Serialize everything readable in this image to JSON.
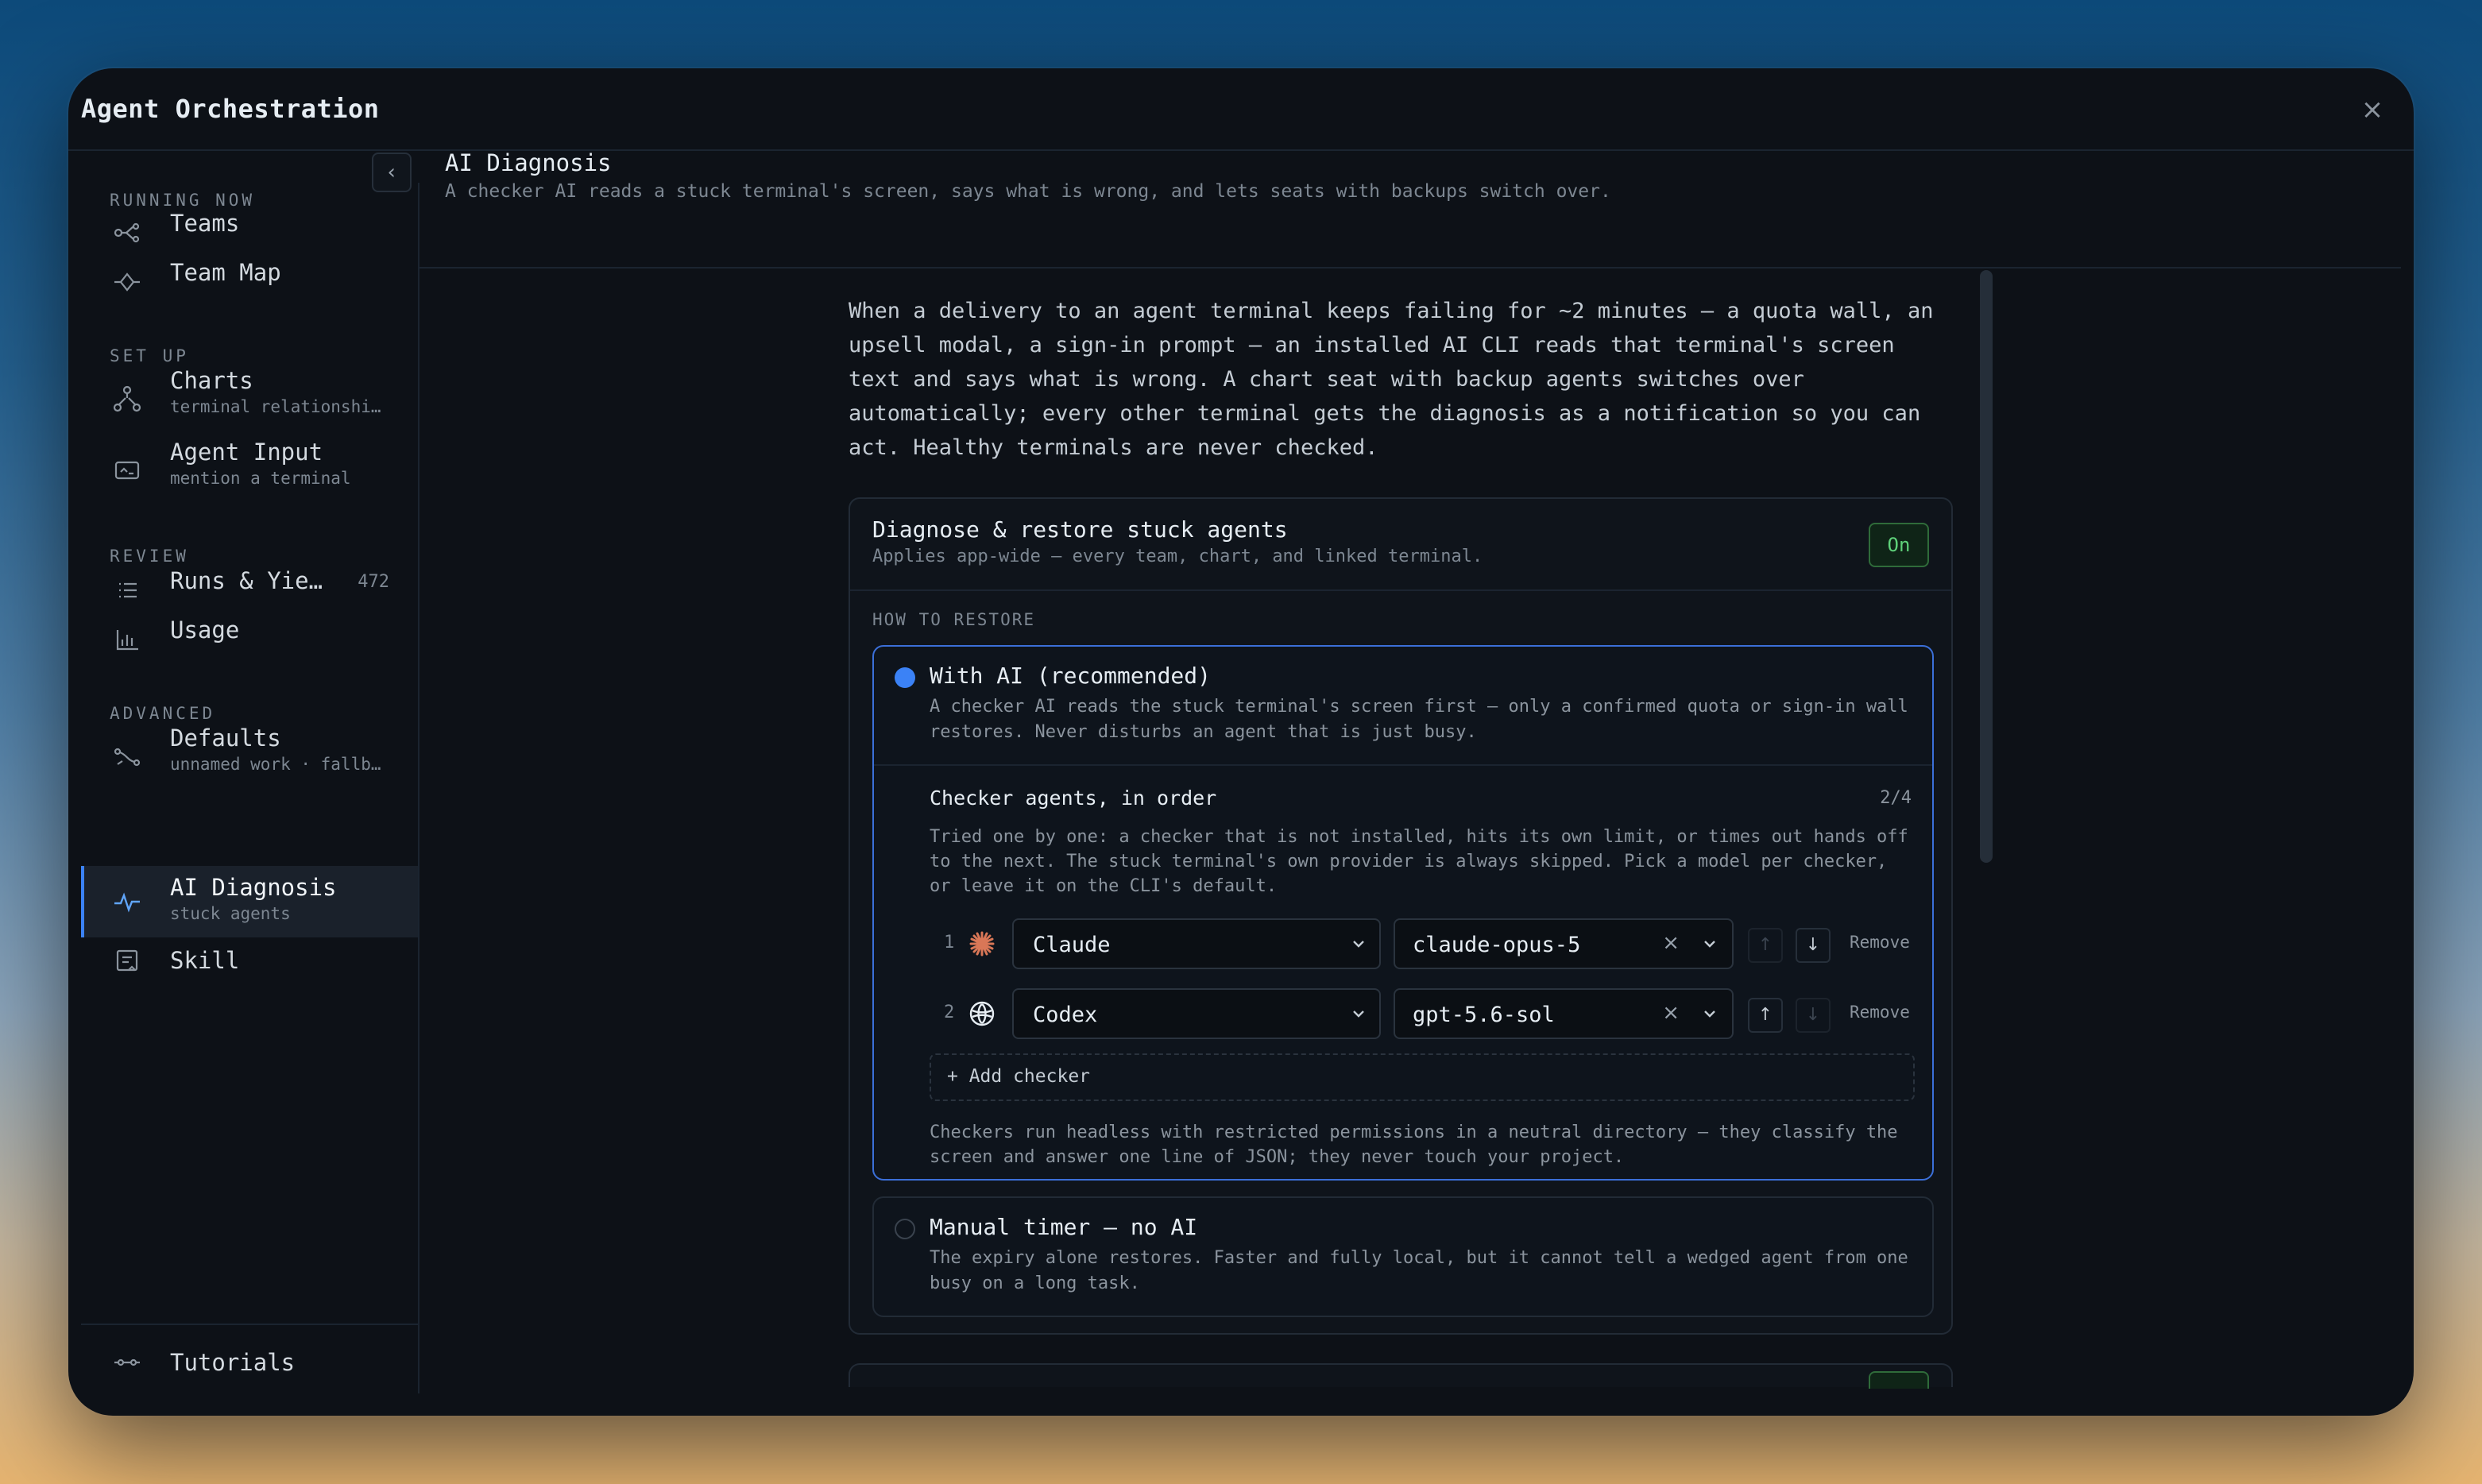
{
  "window": {
    "title": "Agent Orchestration",
    "close": "×"
  },
  "sidebar": {
    "collapse": "‹",
    "sections": {
      "running": "RUNNING NOW",
      "setup": "SET UP",
      "review": "REVIEW",
      "advanced": "ADVANCED"
    },
    "items": [
      {
        "label": "Teams",
        "icon": "teams-icon"
      },
      {
        "label": "Team Map",
        "icon": "map-icon"
      },
      {
        "label": "Charts",
        "sub": "terminal relationshi…",
        "icon": "chart-tree-icon"
      },
      {
        "label": "Agent Input",
        "sub": "mention a terminal",
        "icon": "input-icon"
      },
      {
        "label": "Runs & Yie…",
        "count": "472",
        "icon": "list-icon"
      },
      {
        "label": "Usage",
        "icon": "bar-chart-icon"
      },
      {
        "label": "Defaults",
        "sub": "unnamed work · fallb…",
        "icon": "route-icon"
      },
      {
        "label": "AI Diagnosis",
        "sub": "stuck agents",
        "icon": "pulse-icon",
        "active": true
      },
      {
        "label": "Skill",
        "icon": "skill-icon"
      }
    ],
    "footer": {
      "label": "Tutorials",
      "icon": "tutorials-icon"
    }
  },
  "main": {
    "title": "AI Diagnosis",
    "subtitle": "A checker AI reads a stuck terminal's screen, says what is wrong, and lets seats with backups switch over.",
    "intro": "When a delivery to an agent terminal keeps failing for ~2 minutes — a quota wall, an upsell modal, a sign-in prompt — an installed AI CLI reads that terminal's screen text and says what is wrong. A chart seat with backup agents switches over automatically; every other terminal gets the diagnosis as a notification so you can act. Healthy terminals are never checked."
  },
  "card": {
    "title": "Diagnose & restore stuck agents",
    "subtitle": "Applies app-wide — every team, chart, and linked terminal.",
    "toggle": "On",
    "how_label": "HOW TO RESTORE",
    "option_ai": {
      "title": "With AI (recommended)",
      "desc": "A checker AI reads the stuck terminal's screen first — only a confirmed quota or sign-in wall restores. Never disturbs an agent that is just busy.",
      "checkers_title": "Checker agents, in order",
      "checkers_count": "2/4",
      "checkers_desc": "Tried one by one: a checker that is not installed, hits its own limit, or times out hands off to the next. The stuck terminal's own provider is always skipped. Pick a model per checker, or leave it on the CLI's default.",
      "rows": [
        {
          "num": "1",
          "agent": "Claude",
          "model": "claude-opus-5",
          "remove": "Remove"
        },
        {
          "num": "2",
          "agent": "Codex",
          "model": "gpt-5.6-sol",
          "remove": "Remove"
        }
      ],
      "add": "+ Add checker",
      "note": "Checkers run headless with restricted permissions in a neutral directory — they classify the screen and answer one line of JSON; they never touch your project."
    },
    "option_manual": {
      "title": "Manual timer — no AI",
      "desc": "The expiry alone restores. Faster and fully local, but it cannot tell a wedged agent from one busy on a long task."
    }
  },
  "colors": {
    "accent": "#3b82f6",
    "on_green": "#5fd27a",
    "bg": "#0d1117"
  }
}
